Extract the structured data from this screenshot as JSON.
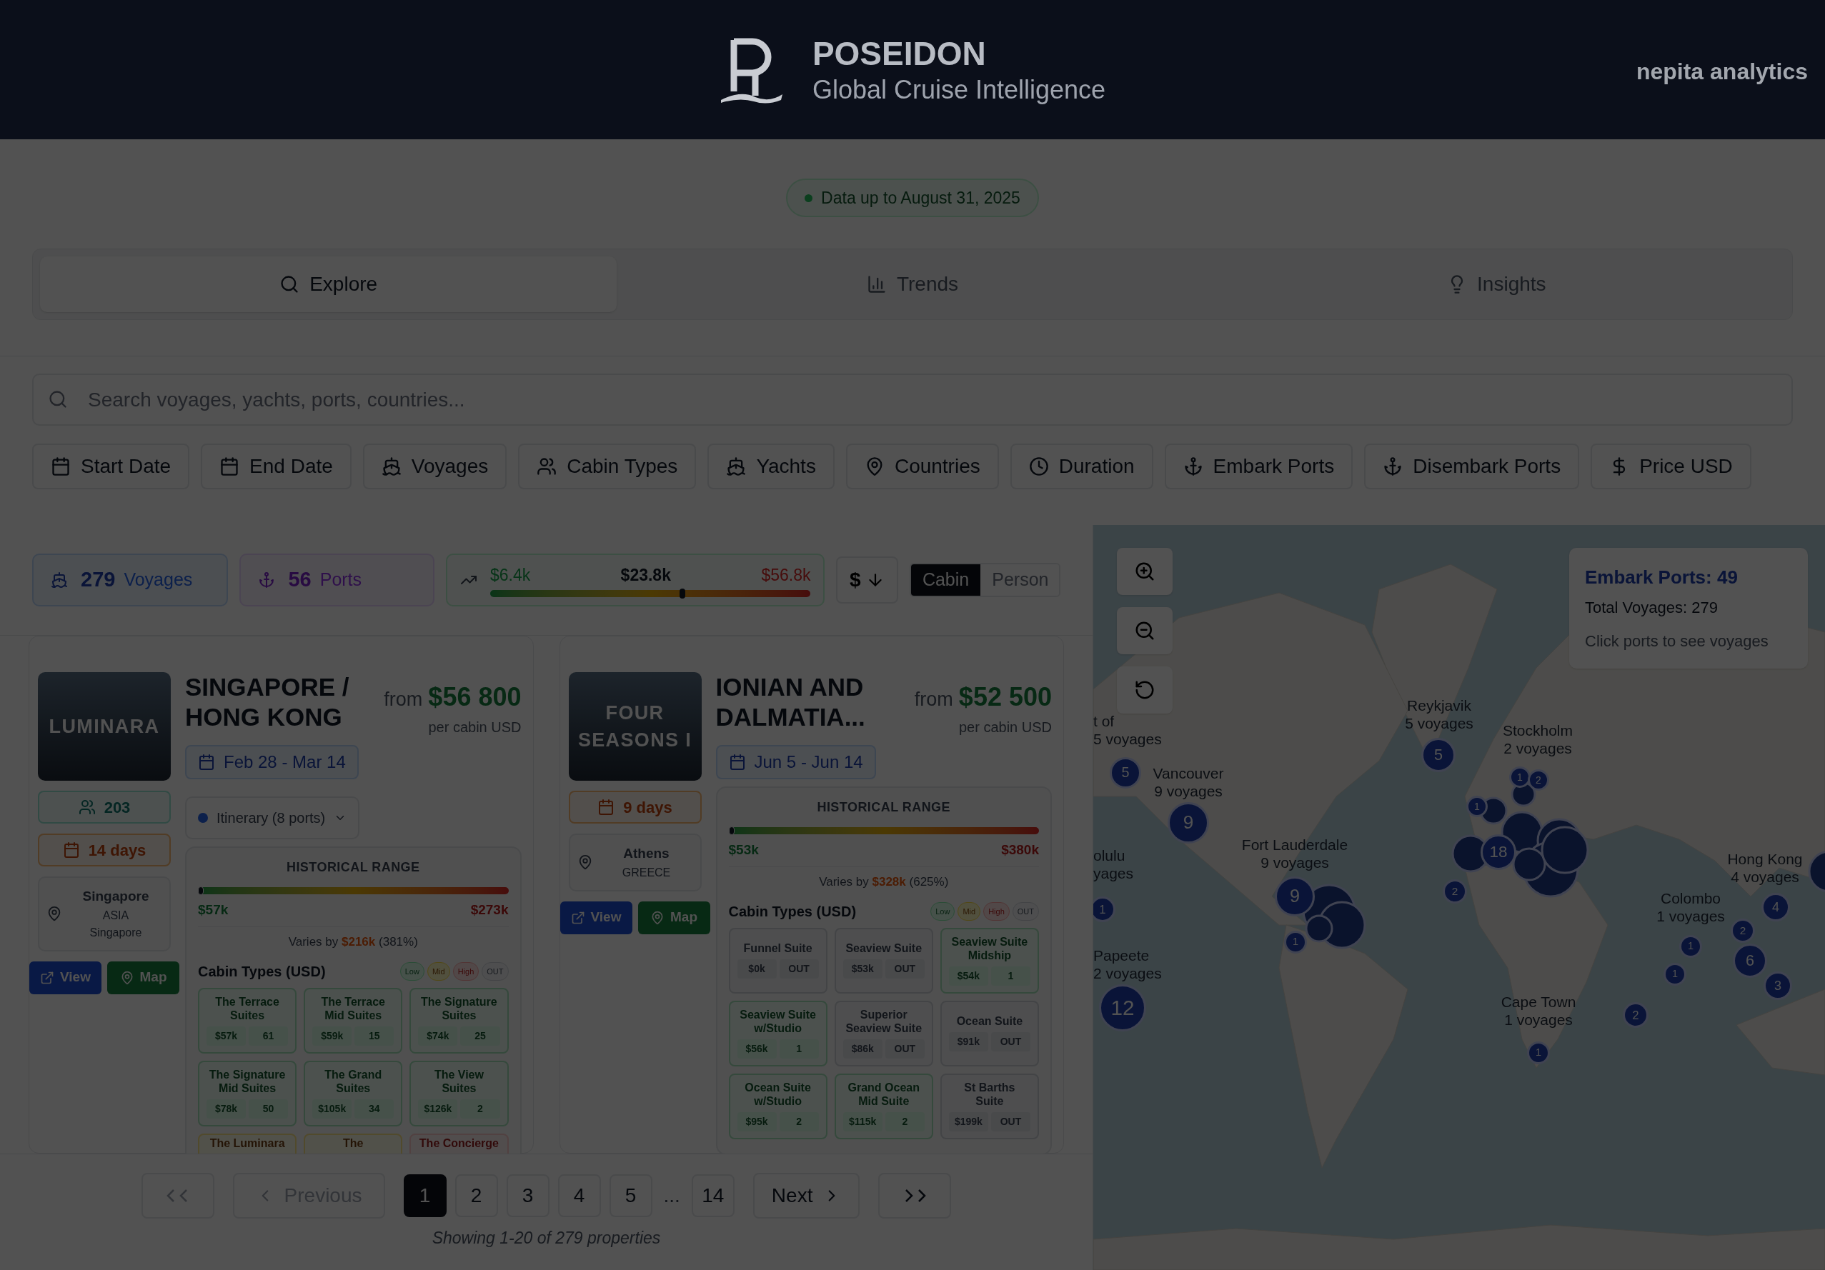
{
  "header": {
    "title": "POSEIDON",
    "subtitle": "Global Cruise Intelligence",
    "brand": "nepita analytics"
  },
  "data_badge": "Data up to August 31, 2025",
  "tabs": [
    {
      "label": "Explore",
      "selected": true
    },
    {
      "label": "Trends",
      "selected": false
    },
    {
      "label": "Insights",
      "selected": false
    }
  ],
  "search": {
    "placeholder": "Search voyages, yachts, ports, countries..."
  },
  "filters": [
    "Start Date",
    "End Date",
    "Voyages",
    "Cabin Types",
    "Yachts",
    "Countries",
    "Duration",
    "Embark Ports",
    "Disembark Ports",
    "Price USD"
  ],
  "stats": {
    "voyages_count": "279",
    "voyages_label": "Voyages",
    "ports_count": "56",
    "ports_label": "Ports"
  },
  "price_range": {
    "min": "$6.4k",
    "mid": "$23.8k",
    "max": "$56.8k",
    "level": 0.6
  },
  "sort_button": "$",
  "price_basis": [
    {
      "label": "Cabin",
      "selected": true
    },
    {
      "label": "Person",
      "selected": false
    }
  ],
  "cards": [
    {
      "ship": "LUMINARA",
      "title": "SINGAPORE / HONG KONG",
      "from": "from",
      "price": "$56 800",
      "price_note": "per cabin USD",
      "dates": "Feb 28 - Mar 14",
      "guests": "203",
      "duration": "14 days",
      "port": "Singapore",
      "region": "ASIA",
      "country": "Singapore",
      "itinerary": "Itinerary (8 ports)",
      "range_title": "HISTORICAL RANGE",
      "range_min": "$57k",
      "range_max": "$273k",
      "varies": "Varies by",
      "varies_amount": "$216k",
      "varies_percent": "(381%)",
      "cabin_title": "Cabin Types (USD)",
      "legend": [
        {
          "label": "Low",
          "kind": "low"
        },
        {
          "label": "Mid",
          "kind": "mid"
        },
        {
          "label": "High",
          "kind": "high"
        },
        {
          "label": "OUT",
          "kind": "out"
        }
      ],
      "cabins": [
        {
          "name": "The Terrace Suites",
          "price": "$57k",
          "count": "61",
          "kind": "low"
        },
        {
          "name": "The Terrace Mid Suites",
          "price": "$59k",
          "count": "15",
          "kind": "low"
        },
        {
          "name": "The Signature Suites",
          "price": "$74k",
          "count": "25",
          "kind": "low"
        },
        {
          "name": "The Signature Mid Suites",
          "price": "$78k",
          "count": "50",
          "kind": "low"
        },
        {
          "name": "The Grand Suites",
          "price": "$105k",
          "count": "34",
          "kind": "low"
        },
        {
          "name": "The View Suites",
          "price": "$126k",
          "count": "2",
          "kind": "low"
        },
        {
          "name": "The Luminara",
          "kind": "mid"
        },
        {
          "name": "The",
          "kind": "mid"
        },
        {
          "name": "The Concierge",
          "kind": "high"
        }
      ],
      "view": "View",
      "map": "Map"
    },
    {
      "ship": "FOUR SEASONS I",
      "title": "IONIAN AND DALMATIA...",
      "from": "from",
      "price": "$52 500",
      "price_note": "per cabin USD",
      "dates": "Jun 5 - Jun 14",
      "duration": "9 days",
      "port": "Athens",
      "country": "GREECE",
      "range_title": "HISTORICAL RANGE",
      "range_min": "$53k",
      "range_max": "$380k",
      "varies": "Varies by",
      "varies_amount": "$328k",
      "varies_percent": "(625%)",
      "cabin_title": "Cabin Types (USD)",
      "legend": [
        {
          "label": "Low",
          "kind": "low"
        },
        {
          "label": "Mid",
          "kind": "mid"
        },
        {
          "label": "High",
          "kind": "high"
        },
        {
          "label": "OUT",
          "kind": "out"
        }
      ],
      "cabins": [
        {
          "name": "Funnel Suite",
          "price": "$0k",
          "count": "OUT",
          "kind": "out"
        },
        {
          "name": "Seaview Suite",
          "price": "$53k",
          "count": "OUT",
          "kind": "out"
        },
        {
          "name": "Seaview Suite Midship",
          "price": "$54k",
          "count": "1",
          "kind": "low"
        },
        {
          "name": "Seaview Suite w/Studio",
          "price": "$56k",
          "count": "1",
          "kind": "low"
        },
        {
          "name": "Superior Seaview Suite",
          "price": "$86k",
          "count": "OUT",
          "kind": "out"
        },
        {
          "name": "Ocean Suite",
          "price": "$91k",
          "count": "OUT",
          "kind": "out"
        },
        {
          "name": "Ocean Suite w/Studio",
          "price": "$95k",
          "count": "2",
          "kind": "low"
        },
        {
          "name": "Grand Ocean Mid Suite",
          "price": "$115k",
          "count": "2",
          "kind": "low"
        },
        {
          "name": "St Barths Suite",
          "price": "$199k",
          "count": "OUT",
          "kind": "out"
        }
      ],
      "view": "View",
      "map": "Map"
    }
  ],
  "pagination": {
    "previous": "Previous",
    "next": "Next",
    "pages": [
      {
        "label": "1",
        "selected": true
      },
      {
        "label": "2",
        "selected": false
      },
      {
        "label": "3",
        "selected": false
      },
      {
        "label": "4",
        "selected": false
      },
      {
        "label": "5",
        "selected": false
      }
    ],
    "ellipsis": "...",
    "last": "14",
    "summary": "Showing 1-20 of 279 properties"
  },
  "map": {
    "info_title": "Embark Ports: 49",
    "info_total": "Total Voyages: 279",
    "info_hint": "Click ports to see voyages",
    "labels": [
      {
        "city": "t of",
        "voyages": "5 voyages"
      },
      {
        "city": "Reykjavik",
        "voyages": "5 voyages"
      },
      {
        "city": "Stockholm",
        "voyages": "2 voyages"
      },
      {
        "city": "Vancouver",
        "voyages": "9 voyages"
      },
      {
        "city": "Fort Lauderdale",
        "voyages": "9 voyages"
      },
      {
        "city": "olulu",
        "voyages": "yages"
      },
      {
        "city": "Hong Kong",
        "voyages": "4 voyages"
      },
      {
        "city": "Colombo",
        "voyages": "1 voyages"
      },
      {
        "city": "Papeete",
        "voyages": "2 voyages"
      },
      {
        "city": "Cape Town",
        "voyages": "1 voyages"
      }
    ],
    "markers": [
      {
        "count": "5"
      },
      {
        "count": "9"
      },
      {
        "count": "5"
      },
      {
        "count": "1"
      },
      {
        "count": "12"
      },
      {
        "count": "9"
      },
      {
        "count": "1"
      },
      {
        "count": "1"
      },
      {
        "count": "2"
      },
      {
        "count": "1"
      },
      {
        "count": "18"
      },
      {
        "count": "2"
      },
      {
        "count": "4"
      },
      {
        "count": "2"
      },
      {
        "count": "6"
      },
      {
        "count": "3"
      },
      {
        "count": "1"
      },
      {
        "count": "1"
      },
      {
        "count": "2"
      },
      {
        "count": "1"
      }
    ]
  }
}
